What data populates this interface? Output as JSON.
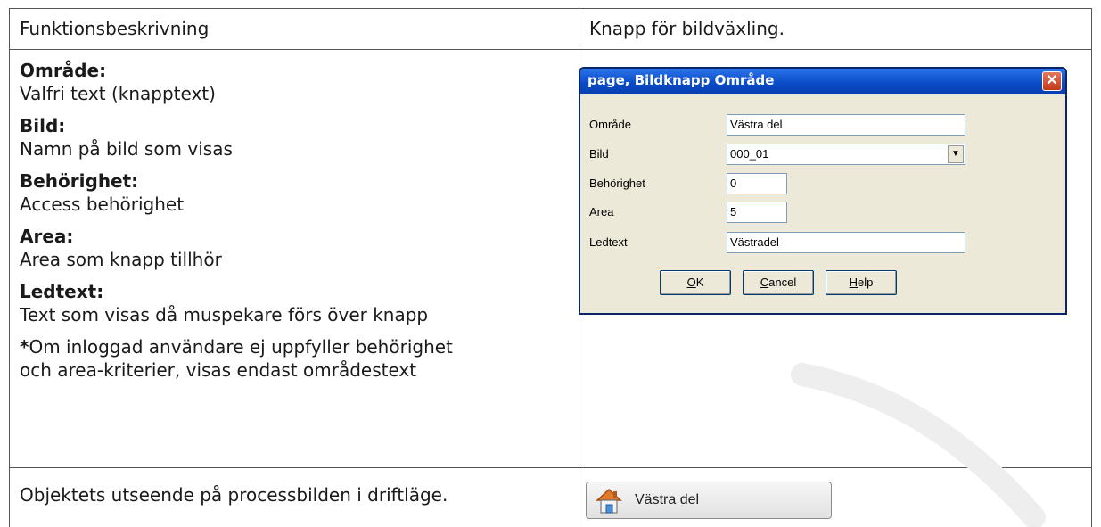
{
  "table": {
    "row1": {
      "left": "Funktionsbeskrivning",
      "right": "Knapp för bildväxling."
    },
    "fields": [
      {
        "title": "Område:",
        "desc": "Valfri text (knapptext)"
      },
      {
        "title": "Bild:",
        "desc": "Namn på bild som visas"
      },
      {
        "title": "Behörighet:",
        "desc": "Access behörighet"
      },
      {
        "title": "Area:",
        "desc": "Area som knapp tillhör"
      },
      {
        "title": "Ledtext:",
        "desc": "Text som visas då muspekare förs över knapp"
      }
    ],
    "note_star": "*",
    "note_line1": "Om inloggad användare ej uppfyller behörighet",
    "note_line2": "och area-kriterier, visas endast områdestext",
    "row3_left": "Objektets utseende på processbilden i driftläge."
  },
  "dialog": {
    "title": "page, Bildknapp Område",
    "close_label": "✕",
    "fields": [
      {
        "label": "Område",
        "value": "Västra del"
      },
      {
        "label": "Bild",
        "value": "000_01"
      },
      {
        "label": "Behörighet",
        "value": "0"
      },
      {
        "label": "Area",
        "value": "5"
      },
      {
        "label": "Ledtext",
        "value": "Västradel"
      }
    ],
    "buttons": {
      "ok_ul": "O",
      "ok_rest": "K",
      "cancel_ul": "C",
      "cancel_rest": "ancel",
      "help_ul": "H",
      "help_rest": "elp"
    },
    "select_arrow": "▼"
  },
  "runtime_button": {
    "label": "Västra del",
    "icon": "house-icon"
  },
  "colors": {
    "titlebar": "#0a4bc8",
    "dialog_bg": "#ece9d8",
    "close": "#c4391c"
  }
}
